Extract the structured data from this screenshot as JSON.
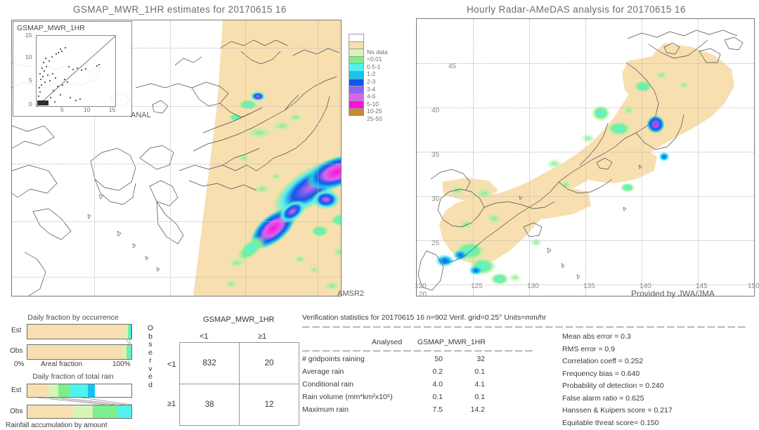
{
  "left_panel": {
    "title": "GSMAP_MWR_1HR estimates for 20170615 16",
    "inset_title": "GSMAP_MWR_1HR",
    "inset_axis_label": "ANAL",
    "inset_ticks": [
      "0",
      "5",
      "10",
      "15"
    ],
    "corner_label": "AMSR2"
  },
  "right_panel": {
    "title": "Hourly Radar-AMeDAS analysis for 20170615 16",
    "credit": "Provided by JWA/JMA",
    "lon_ticks": [
      "120",
      "125",
      "130",
      "135",
      "140",
      "145",
      "150"
    ],
    "lat_ticks": [
      "45",
      "40",
      "35",
      "30",
      "25",
      "20"
    ]
  },
  "colorbar": {
    "entries": [
      {
        "label": "",
        "color": "#ffffff"
      },
      {
        "label": "No data",
        "color": "#f8dfb0"
      },
      {
        "label": "<0.01",
        "color": "#d8f3b8"
      },
      {
        "label": "0.5-1",
        "color": "#7cef8c"
      },
      {
        "label": "1-2",
        "color": "#53f2f2"
      },
      {
        "label": "2-3",
        "color": "#14c3f0"
      },
      {
        "label": "3-4",
        "color": "#1256ea"
      },
      {
        "label": "4-5",
        "color": "#8d66f0"
      },
      {
        "label": "5-10",
        "color": "#d964ee"
      },
      {
        "label": "10-25",
        "color": "#fa10d8"
      },
      {
        "label": "25-50",
        "color": "#c98a2e"
      }
    ]
  },
  "occurrence_chart": {
    "title": "Daily fraction by occurrence",
    "rows": [
      "Est",
      "Obs"
    ],
    "axis_left": "0%",
    "axis_center": "Areal fraction",
    "axis_right": "100%",
    "est_segments": [
      {
        "color": "#f8dfb0",
        "pct": 94.5
      },
      {
        "color": "#d8f3b8",
        "pct": 2.2
      },
      {
        "color": "#7cef8c",
        "pct": 1.6
      },
      {
        "color": "#53f2f2",
        "pct": 1.2
      },
      {
        "color": "#14c3f0",
        "pct": 0.5
      }
    ],
    "obs_segments": [
      {
        "color": "#f8dfb0",
        "pct": 92.5
      },
      {
        "color": "#d8f3b8",
        "pct": 3.0
      },
      {
        "color": "#7cef8c",
        "pct": 3.0
      },
      {
        "color": "#53f2f2",
        "pct": 1.5
      }
    ]
  },
  "amount_chart": {
    "title": "Daily fraction of total rain",
    "footer": "Rainfall accumulation by amount",
    "rows": [
      "Est",
      "Obs"
    ],
    "est_segments": [
      {
        "color": "#f8dfb0",
        "pct": 20.0
      },
      {
        "color": "#d8f3b8",
        "pct": 10.0
      },
      {
        "color": "#7cef8c",
        "pct": 11.0
      },
      {
        "color": "#53f2f2",
        "pct": 17.0
      },
      {
        "color": "#14c3f0",
        "pct": 7.0
      }
    ],
    "obs_segments": [
      {
        "color": "#f8dfb0",
        "pct": 44.0
      },
      {
        "color": "#d8f3b8",
        "pct": 19.0
      },
      {
        "color": "#7cef8c",
        "pct": 24.0
      },
      {
        "color": "#53f2f2",
        "pct": 13.0
      }
    ]
  },
  "contingency": {
    "title": "GSMAP_MWR_1HR",
    "col_headers": [
      "<1",
      "≥1"
    ],
    "row_headers": [
      "<1",
      "≥1"
    ],
    "side_label": "Observed",
    "cells": [
      [
        "832",
        "20"
      ],
      [
        "38",
        "12"
      ]
    ]
  },
  "verification": {
    "header": "Verification statistics for 20170615 16  n=902  Verif. grid=0.25°  Units=mm/hr",
    "divider": "— — — — — — — — — — — — — — — — — — — — — — — — — — — — — — — — — — — — — — — — — — — —",
    "sub_divider": "— — — — — — — — — — — — — — — — — — — — — — —",
    "col_analysed": "Analysed",
    "col_model": "GSMAP_MWR_1HR",
    "rows": [
      {
        "label": "# gridpoints raining",
        "analysed": "50",
        "model": "32"
      },
      {
        "label": "Average rain",
        "analysed": "0.2",
        "model": "0.1"
      },
      {
        "label": "Conditional rain",
        "analysed": "4.0",
        "model": "4.1"
      },
      {
        "label": "Rain volume (mm*km²x10⁶)",
        "analysed": "0.1",
        "model": "0.1"
      },
      {
        "label": "Maximum rain",
        "analysed": "7.5",
        "model": "14.2"
      }
    ],
    "scores": [
      "Mean abs error = 0.3",
      "RMS error = 0.9",
      "Correlation coeff = 0.252",
      "Frequency bias = 0.640",
      "Probability of detection = 0.240",
      "False alarm ratio = 0.625",
      "Hanssen & Kuipers score = 0.217",
      "Equitable threat score= 0.150"
    ]
  }
}
